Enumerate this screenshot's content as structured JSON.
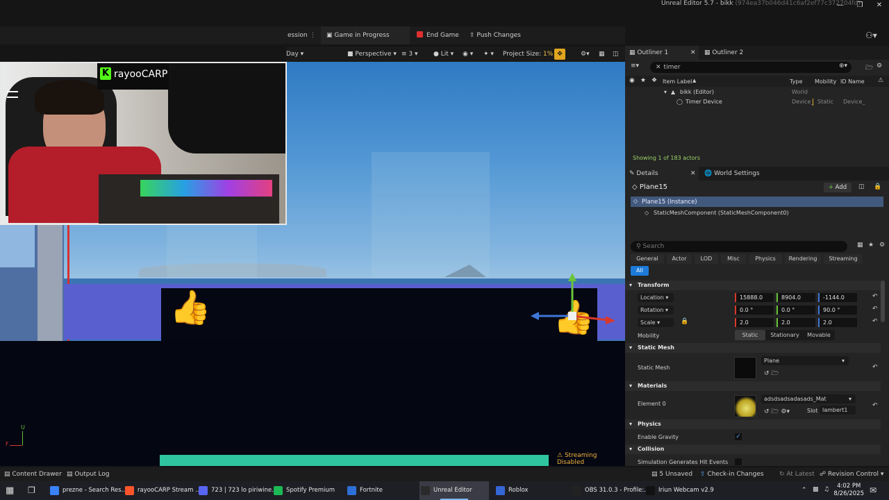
{
  "window": {
    "title": "Unreal Editor 5.7 - bikk",
    "title_hash": "(974ea37b046d41c6af2ef77c372704fd)"
  },
  "toolbar": {
    "session_label": "ession",
    "game_in_progress": "Game in Progress",
    "end_game": "End Game",
    "push_changes": "Push Changes"
  },
  "viewport_toolbar": {
    "day": "Day",
    "perspective": "Perspective",
    "camera_speed": "3",
    "lit": "Lit",
    "project_size_label": "Project Size:",
    "project_size_value": "1%"
  },
  "webcam": {
    "channel": "rayooCARP"
  },
  "viewport": {
    "streaming_disabled": "Streaming Disabled",
    "axis_up": "U",
    "axis_forward": "F"
  },
  "outliner": {
    "tab1": "Outliner 1",
    "tab2": "Outliner 2",
    "search_value": "timer",
    "columns": [
      "Item Label",
      "Type",
      "Mobility",
      "ID Name"
    ],
    "rows": [
      {
        "label": "bikk (Editor)",
        "type": "World",
        "mobility": "",
        "id": ""
      },
      {
        "label": "Timer Device",
        "type": "Device_",
        "mobility": "Static",
        "id": "Device_"
      }
    ],
    "showing": "Showing 1 of 183 actors"
  },
  "details": {
    "tab1": "Details",
    "tab2": "World Settings",
    "actor_name": "Plane15",
    "add_label": "Add",
    "instance": "Plane15 (Instance)",
    "component": "StaticMeshComponent (StaticMeshComponent0)",
    "search_placeholder": "Search",
    "categories": [
      "General",
      "Actor",
      "LOD",
      "Misc",
      "Physics",
      "Rendering",
      "Streaming",
      "All"
    ],
    "transform": {
      "header": "Transform",
      "location_label": "Location",
      "rotation_label": "Rotation",
      "scale_label": "Scale",
      "location": [
        "15888.0",
        "8904.0",
        "-1144.0"
      ],
      "rotation": [
        "0.0 °",
        "0.0 °",
        "90.0 °"
      ],
      "scale": [
        "2.0",
        "2.0",
        "2.0"
      ],
      "mobility_label": "Mobility",
      "mobility_options": [
        "Static",
        "Stationary",
        "Movable"
      ]
    },
    "static_mesh": {
      "header": "Static Mesh",
      "label": "Static Mesh",
      "value": "Plane"
    },
    "materials": {
      "header": "Materials",
      "element_label": "Element 0",
      "value": "adsdsadsadasads_Mat",
      "slot_label": "Slot",
      "slot_value": "lambert1"
    },
    "physics": {
      "header": "Physics",
      "enable_gravity": "Enable Gravity"
    },
    "collision": {
      "header": "Collision",
      "sim_hit": "Simulation Generates Hit Events"
    }
  },
  "statusbar": {
    "content_drawer": "Content Drawer",
    "output_log": "Output Log",
    "unsaved": "5 Unsaved",
    "check_in": "Check-in Changes",
    "at_latest": "At Latest",
    "revision": "Revision Control"
  },
  "taskbar": {
    "items": [
      {
        "label": "prezne - Search Res...",
        "color": "#3b82f6"
      },
      {
        "label": "rayooCARP Stream ...",
        "color": "#fb542b"
      },
      {
        "label": "723 | 723 lo piriwine...",
        "color": "#5865f2"
      },
      {
        "label": "Spotify Premium",
        "color": "#1db954"
      },
      {
        "label": "Fortnite",
        "color": "#2d6fd6"
      },
      {
        "label": "Unreal Editor",
        "color": "#2a2a2a"
      },
      {
        "label": "Roblox",
        "color": "#3566d6"
      },
      {
        "label": "OBS 31.0.3 - Profile:...",
        "color": "#222"
      },
      {
        "label": "Iriun Webcam v2.9",
        "color": "#111"
      }
    ],
    "time": "4:02 PM",
    "date": "8/26/2025"
  }
}
